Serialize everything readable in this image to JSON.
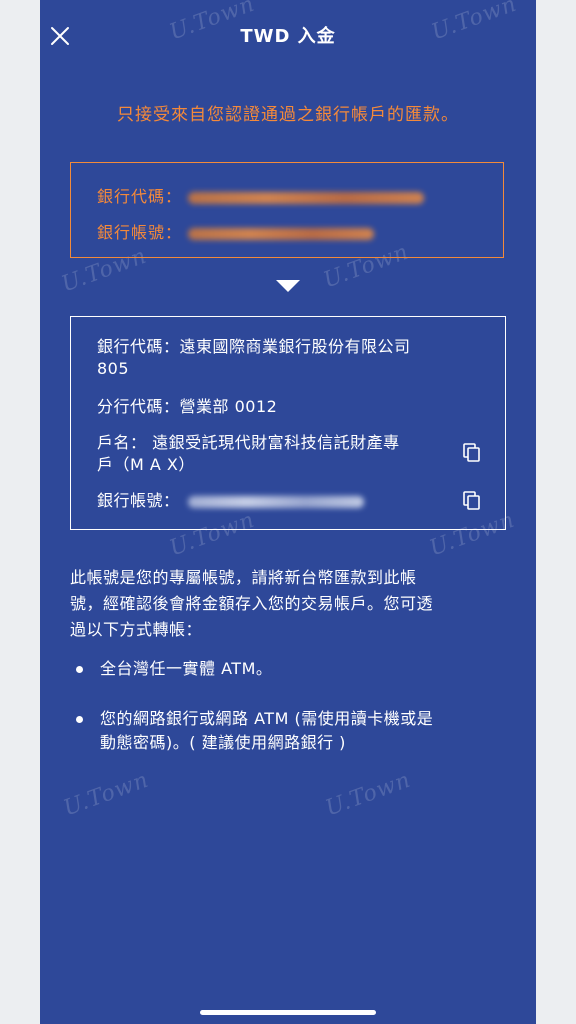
{
  "header": {
    "title": "TWD 入金"
  },
  "notice": "只接受來自您認證通過之銀行帳戶的匯款。",
  "source_account": {
    "bank_code_label": "銀行代碼：",
    "account_no_label": "銀行帳號："
  },
  "destination": {
    "bank_code_line1": "銀行代碼：遠東國際商業銀行股份有限公司",
    "bank_code_line2": "805",
    "branch_code": "分行代碼：營業部 0012",
    "account_name_line1": "戶名： 遠銀受託現代財富科技信託財產專",
    "account_name_line2": "戶（M A X）",
    "account_no_label": "銀行帳號："
  },
  "description": {
    "line1": "此帳號是您的專屬帳號，請將新台幣匯款到此帳",
    "line2": "號，經確認後會將金額存入您的交易帳戶。您可透",
    "line3": "過以下方式轉帳："
  },
  "methods": [
    {
      "line1": "全台灣任一實體 ATM。"
    },
    {
      "line1": "您的網路銀行或網路 ATM (需使用讀卡機或是",
      "line2": "動態密碼)。( 建議使用網路銀行 )"
    }
  ],
  "watermark": "U.Town",
  "colors": {
    "background": "#2e4899",
    "accent": "#f4893a",
    "text": "#ffffff"
  },
  "icons": {
    "close": "close-icon",
    "arrow": "arrow-down-icon",
    "copy": "copy-icon"
  }
}
